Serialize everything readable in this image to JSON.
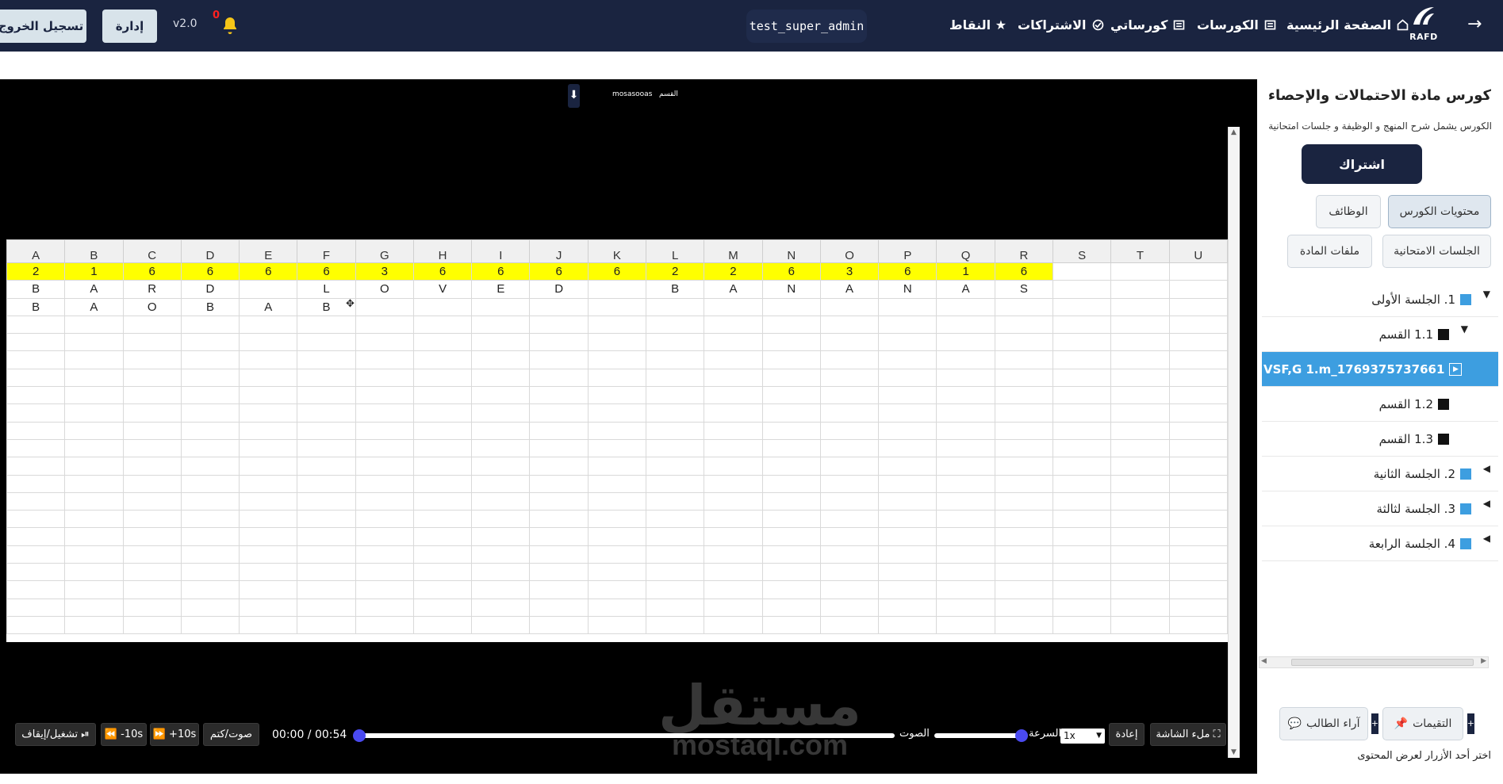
{
  "header": {
    "logout": "تسجيل الخروج",
    "admin": "إدارة",
    "version": "v2.0",
    "notifications": "0",
    "username": "test_super_admin",
    "nav": [
      "الصفحة الرئيسية",
      "الكورسات",
      "كورساتي",
      "الاشتراكات",
      "★ النقاط"
    ],
    "logo": "RAFD",
    "back_arrow": "→"
  },
  "video": {
    "down_label": "⬇",
    "header_left": "mosasooas",
    "header_right": "القسم",
    "sheet": {
      "columns": [
        "A",
        "B",
        "C",
        "D",
        "E",
        "F",
        "G",
        "H",
        "I",
        "J",
        "K",
        "L",
        "M",
        "N",
        "O",
        "P",
        "Q",
        "R",
        "S",
        "T",
        "U"
      ],
      "rows": [
        [
          "2",
          "1",
          "6",
          "6",
          "6",
          "6",
          "3",
          "6",
          "6",
          "6",
          "6",
          "2",
          "2",
          "6",
          "3",
          "6",
          "1",
          "6",
          "",
          "",
          ""
        ],
        [
          "B",
          "A",
          "R",
          "D",
          "",
          "L",
          "O",
          "V",
          "E",
          "D",
          "",
          "B",
          "A",
          "N",
          "A",
          "N",
          "A",
          "S",
          "",
          "",
          ""
        ],
        [
          "B",
          "A",
          "O",
          "B",
          "A",
          "B",
          "",
          "",
          "",
          "",
          "",
          "",
          "",
          "",
          "",
          "",
          "",
          "",
          "",
          "",
          ""
        ]
      ],
      "highlight_row": 0,
      "highlight_color": "#ffff00",
      "blank_rows": 18
    },
    "controls": {
      "play_pause": "تشغيل/إيقاف ⏯",
      "back10": "⏪ -10s",
      "fwd10": "⏩ +10s",
      "mute": "صوت/كتم",
      "time": "00:00 / 00:54",
      "volume_label": "الصوت",
      "speed_label": "السرعة",
      "speed_value": "1x",
      "replay": "إعادة",
      "fullscreen": "ملء الشاشة ⛶"
    },
    "watermark_ar": "مستقل",
    "watermark_en": "mostaql.com"
  },
  "sidebar": {
    "title": "كورس مادة الاحتمالات والإحصاء",
    "description": "الكورس يشمل شرح المنهج و الوظيفة و جلسات امتحانية",
    "subscribe": "اشتراك",
    "tabs": [
      "محتويات الكورس",
      "الوظائف",
      "الجلسات الامتحانية",
      "ملفات المادة"
    ],
    "tree": [
      {
        "label": "1. الجلسة الأولى",
        "color": "#3d9ee0",
        "caret": "▼",
        "level": 0
      },
      {
        "label": "1.1 القسم",
        "color": "#111111",
        "caret": "▼",
        "level": 1
      },
      {
        "label": "VSF,G 1.m_1769375737661",
        "color": "#ffffff",
        "caret": "",
        "level": 2,
        "selected": true
      },
      {
        "label": "1.2 القسم",
        "color": "#111111",
        "caret": "",
        "level": 1
      },
      {
        "label": "1.3 القسم",
        "color": "#111111",
        "caret": "",
        "level": 1
      },
      {
        "label": "2. الجلسة الثانية",
        "color": "#3d9ee0",
        "caret": "◀",
        "level": 0
      },
      {
        "label": "3. الجلسة لثالثة",
        "color": "#3d9ee0",
        "caret": "◀",
        "level": 0
      },
      {
        "label": "4. الجلسة الرابعة",
        "color": "#3d9ee0",
        "caret": "◀",
        "level": 0
      }
    ],
    "ratings": "التقيمات",
    "student_opinions": "آراء الطالب",
    "plus": "+",
    "hint": "اختر أحد الأزرار لعرض المحتوى"
  }
}
